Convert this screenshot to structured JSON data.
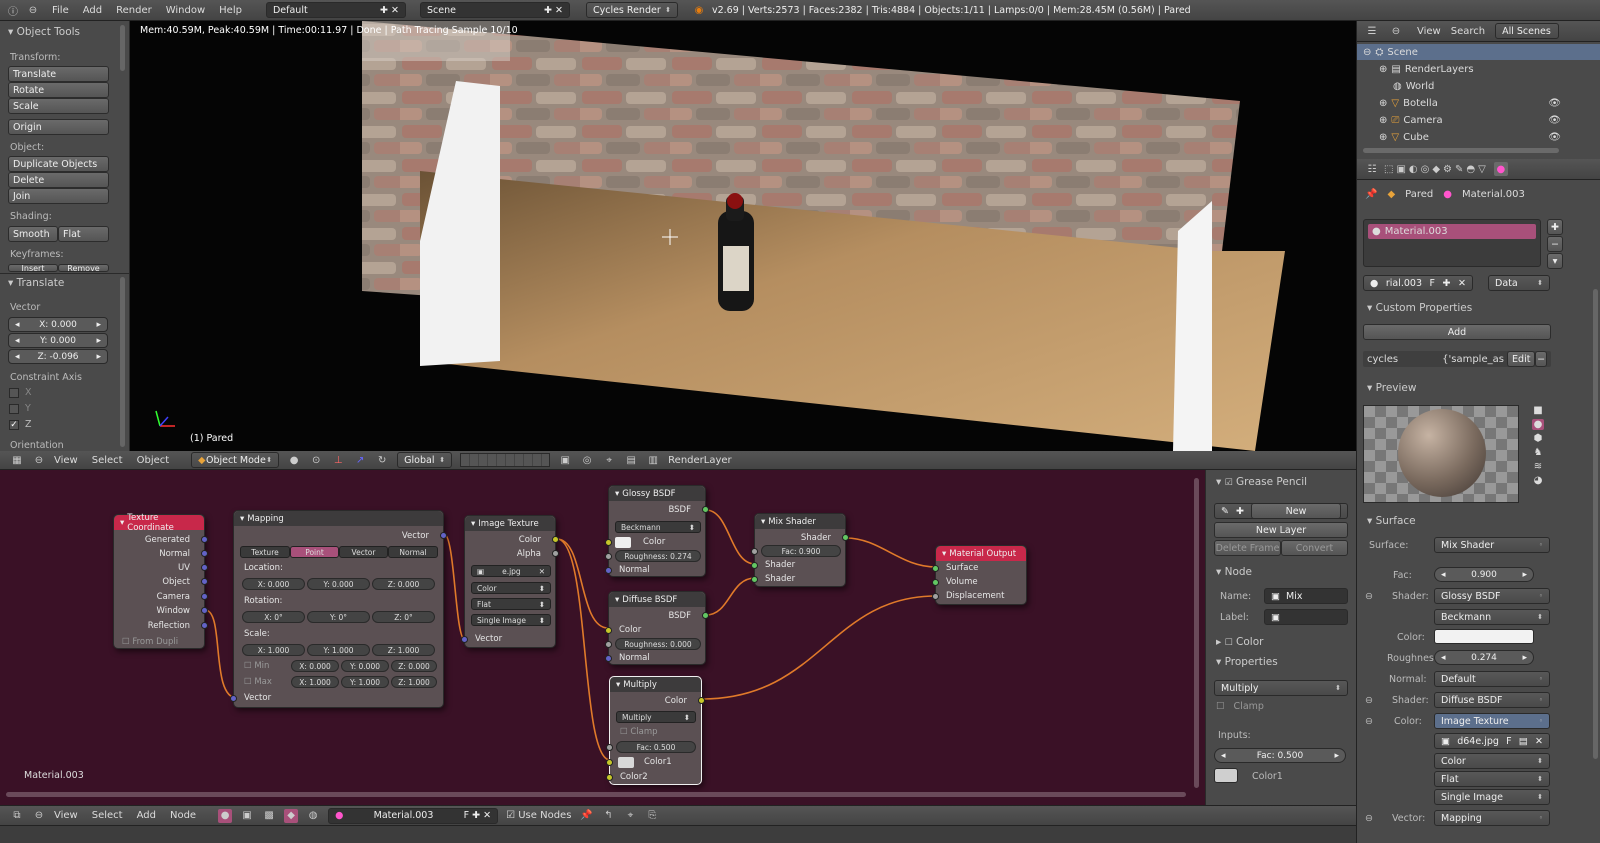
{
  "top_bar": {
    "menus": [
      "File",
      "Add",
      "Render",
      "Window",
      "Help"
    ],
    "layout": "Default",
    "scene": "Scene",
    "engine": "Cycles Render",
    "stats": "v2.69 | Verts:2573 | Faces:2382 | Tris:4884 | Objects:1/11 | Lamps:0/0 | Mem:28.45M (0.56M) | Pared"
  },
  "tool_shelf": {
    "title": "Object Tools",
    "transform_label": "Transform:",
    "translate": "Translate",
    "rotate": "Rotate",
    "scale": "Scale",
    "origin": "Origin",
    "object_label": "Object:",
    "duplicate": "Duplicate Objects",
    "delete": "Delete",
    "join": "Join",
    "shading_label": "Shading:",
    "smooth": "Smooth",
    "flat": "Flat",
    "keyframes_label": "Keyframes:",
    "insert": "Insert",
    "remove": "Remove",
    "op_title": "Translate",
    "vector_label": "Vector",
    "x": "X: 0.000",
    "y": "Y: 0.000",
    "z": "Z: -0.096",
    "constraint_label": "Constraint Axis",
    "cx": "X",
    "cy": "Y",
    "cz": "Z",
    "orientation_label": "Orientation"
  },
  "viewport": {
    "render_info": "Mem:40.59M, Peak:40.59M | Time:00:11.97 | Done | Path Tracing Sample 10/10",
    "object_label": "(1) Pared",
    "header_menus": [
      "View",
      "Select",
      "Object"
    ],
    "mode": "Object Mode",
    "orientation": "Global",
    "render_layer": "RenderLayer"
  },
  "outliner": {
    "menus": [
      "View",
      "Search"
    ],
    "filter": "All Scenes",
    "items": [
      {
        "label": "Scene",
        "indent": 0
      },
      {
        "label": "RenderLayers",
        "indent": 1
      },
      {
        "label": "World",
        "indent": 1
      },
      {
        "label": "Botella",
        "indent": 1
      },
      {
        "label": "Camera",
        "indent": 1
      },
      {
        "label": "Cube",
        "indent": 1
      }
    ]
  },
  "properties": {
    "object_name": "Pared",
    "material_name": "Material.003",
    "slot": "Material.003",
    "datablock": "rial.003",
    "datablock_f": "F",
    "link": "Data",
    "custom_props_title": "Custom Properties",
    "add": "Add",
    "cycles_key": "cycles",
    "cycles_val": "{'sample_as",
    "edit": "Edit",
    "preview_title": "Preview",
    "surface_title": "Surface",
    "surface_label": "Surface:",
    "surface_val": "Mix Shader",
    "fac_label": "Fac:",
    "fac_val": "0.900",
    "shader1_label": "Shader:",
    "shader1_val": "Glossy BSDF",
    "shader1_dist": "Beckmann",
    "color_label": "Color:",
    "rough_label": "Roughnes",
    "rough_val": "0.274",
    "normal_label": "Normal:",
    "normal_val": "Default",
    "shader2_label": "Shader:",
    "shader2_val": "Diffuse BSDF",
    "color2_label": "Color:",
    "color2_val": "Image Texture",
    "image": "d64e.jpg",
    "image_f": "F",
    "color_space": "Color",
    "projection": "Flat",
    "source": "Single Image",
    "vector_label": "Vector:",
    "vector_val": "Mapping"
  },
  "node_sidebar": {
    "grease_title": "Grease Pencil",
    "new": "New",
    "new_layer": "New Layer",
    "delete_frame": "Delete Frame",
    "convert": "Convert",
    "node_title": "Node",
    "name_label": "Name:",
    "name_val": "Mix",
    "label_label": "Label:",
    "color_title": "Color",
    "props_title": "Properties",
    "blend": "Multiply",
    "clamp": "Clamp",
    "inputs_label": "Inputs:",
    "fac": "Fac: 0.500",
    "color1": "Color1"
  },
  "node_editor": {
    "material_label": "Material.003",
    "header_menus": [
      "View",
      "Select",
      "Add",
      "Node"
    ],
    "material": "Material.003",
    "use_nodes": "Use Nodes",
    "tex_coord": {
      "title": "Texture Coordinate",
      "outputs": [
        "Generated",
        "Normal",
        "UV",
        "Object",
        "Camera",
        "Window",
        "Reflection"
      ],
      "from_dupli": "From Dupli"
    },
    "mapping": {
      "title": "Mapping",
      "out": "Vector",
      "tabs": [
        "Texture",
        "Point",
        "Vector",
        "Normal"
      ],
      "location": "Location:",
      "lx": "X: 0.000",
      "ly": "Y: 0.000",
      "lz": "Z: 0.000",
      "rotation": "Rotation:",
      "rx": "X: 0°",
      "ry": "Y: 0°",
      "rz": "Z: 0°",
      "scale": "Scale:",
      "sx": "X: 1.000",
      "sy": "Y: 1.000",
      "sz": "Z: 1.000",
      "min": "Min",
      "minx": "X: 0.000",
      "miny": "Y: 0.000",
      "minz": "Z: 0.000",
      "max": "Max",
      "maxx": "X: 1.000",
      "maxy": "Y: 1.000",
      "maxz": "Z: 1.000",
      "in": "Vector"
    },
    "image_tex": {
      "title": "Image Texture",
      "color": "Color",
      "alpha": "Alpha",
      "file": "e.jpg",
      "cs": "Color",
      "proj": "Flat",
      "src": "Single Image",
      "vector": "Vector"
    },
    "glossy": {
      "title": "Glossy BSDF",
      "out": "BSDF",
      "dist": "Beckmann",
      "color": "Color",
      "rough": "Roughness: 0.274",
      "normal": "Normal"
    },
    "diffuse": {
      "title": "Diffuse BSDF",
      "out": "BSDF",
      "color": "Color",
      "rough": "Roughness: 0.000",
      "normal": "Normal"
    },
    "mix": {
      "title": "Mix Shader",
      "out": "Shader",
      "fac": "Fac: 0.900",
      "s1": "Shader",
      "s2": "Shader"
    },
    "multiply": {
      "title": "Multiply",
      "out": "Color",
      "mode": "Multiply",
      "clamp": "Clamp",
      "fac": "Fac: 0.500",
      "c1": "Color1",
      "c2": "Color2"
    },
    "output": {
      "title": "Material Output",
      "surface": "Surface",
      "volume": "Volume",
      "displacement": "Displacement"
    }
  }
}
